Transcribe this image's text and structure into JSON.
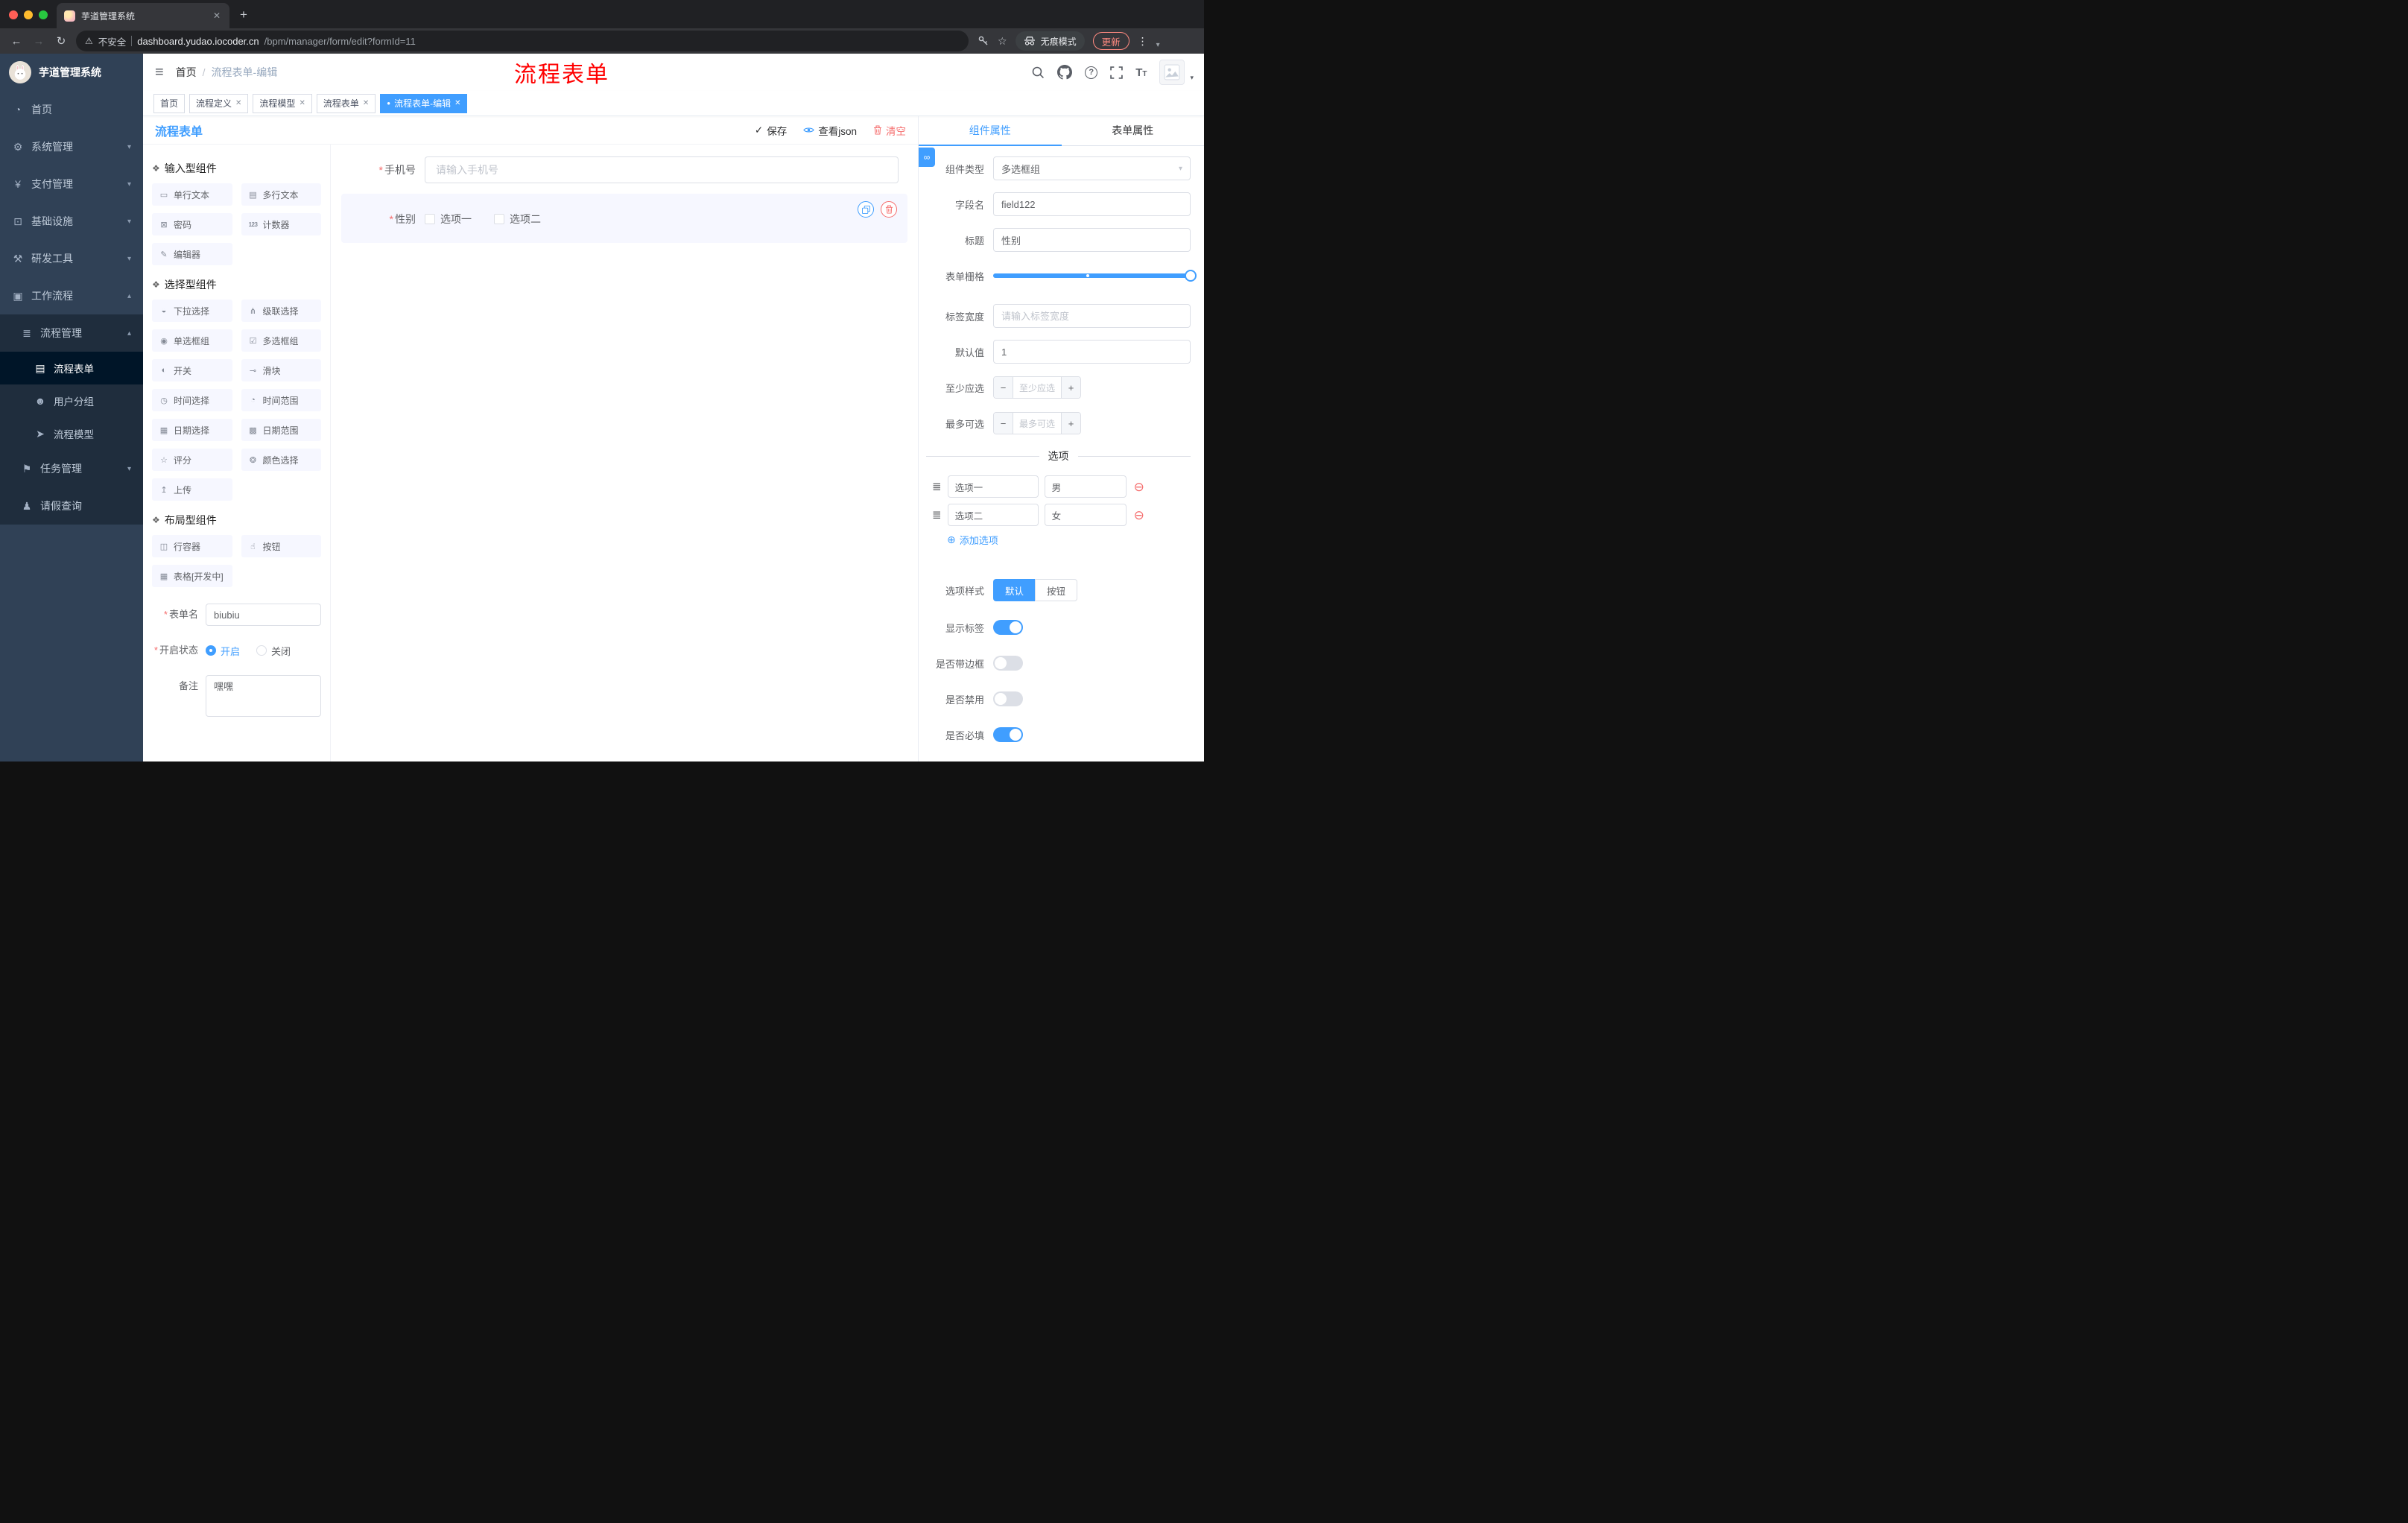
{
  "icons": {
    "back": "←",
    "forward": "→",
    "reload": "↻",
    "warning": "⚠",
    "star": "☆",
    "kebab": "⋮",
    "plus": "+",
    "close": "✕",
    "check": "✓",
    "dot": "●",
    "slash": "/",
    "hamburger": "≡",
    "question": "?",
    "caret_down": "▾",
    "caret_up": "▴",
    "minus": "−",
    "add_circle": "⊕",
    "remove_circle": "⊖",
    "drag_handle": "≣",
    "required": "*",
    "link": "∞",
    "group": "❖",
    "font_large": "T",
    "font_small": "T",
    "counter": "123"
  },
  "browser": {
    "tab_title": "芋道管理系统",
    "security_label": "不安全",
    "url_host": "dashboard.yudao.iocoder.cn",
    "url_path": "/bpm/manager/form/edit?formId=11",
    "incognito_label": "无痕模式",
    "update_label": "更新"
  },
  "sidebar": {
    "logo_title": "芋道管理系统",
    "menu": [
      {
        "label": "首页",
        "glyph": "◔"
      },
      {
        "label": "系统管理",
        "glyph": "⚙"
      },
      {
        "label": "支付管理",
        "glyph": "¥"
      },
      {
        "label": "基础设施",
        "glyph": "⊡"
      },
      {
        "label": "研发工具",
        "glyph": "⚒"
      },
      {
        "label": "工作流程",
        "glyph": "▣"
      },
      {
        "label": "流程管理",
        "glyph": "≣"
      },
      {
        "label": "流程表单",
        "glyph": "▤"
      },
      {
        "label": "用户分组",
        "glyph": "☻"
      },
      {
        "label": "流程模型",
        "glyph": "➤"
      },
      {
        "label": "任务管理",
        "glyph": "⚑"
      },
      {
        "label": "请假查询",
        "glyph": "♟"
      }
    ]
  },
  "header": {
    "breadcrumb_home": "首页",
    "breadcrumb_current": "流程表单-编辑",
    "watermark": "流程表单"
  },
  "tags": [
    {
      "label": "首页"
    },
    {
      "label": "流程定义"
    },
    {
      "label": "流程模型"
    },
    {
      "label": "流程表单"
    },
    {
      "label": "流程表单-编辑"
    }
  ],
  "designer": {
    "title": "流程表单",
    "save": "保存",
    "view_json": "查看json",
    "clear": "清空"
  },
  "components": {
    "groups": [
      {
        "title": "输入型组件",
        "items": [
          {
            "label": "单行文本",
            "glyph": "▭"
          },
          {
            "label": "多行文本",
            "glyph": "▤"
          },
          {
            "label": "密码",
            "glyph": "⊠"
          },
          {
            "label": "计数器",
            "glyph": "123"
          },
          {
            "label": "编辑器",
            "glyph": "✎"
          }
        ]
      },
      {
        "title": "选择型组件",
        "items": [
          {
            "label": "下拉选择",
            "glyph": "◒"
          },
          {
            "label": "级联选择",
            "glyph": "⋔"
          },
          {
            "label": "单选框组",
            "glyph": "◉"
          },
          {
            "label": "多选框组",
            "glyph": "☑"
          },
          {
            "label": "开关",
            "glyph": "◐"
          },
          {
            "label": "滑块",
            "glyph": "⊸"
          },
          {
            "label": "时间选择",
            "glyph": "◷"
          },
          {
            "label": "时间范围",
            "glyph": "◔"
          },
          {
            "label": "日期选择",
            "glyph": "▦"
          },
          {
            "label": "日期范围",
            "glyph": "▩"
          },
          {
            "label": "评分",
            "glyph": "☆"
          },
          {
            "label": "颜色选择",
            "glyph": "❂"
          },
          {
            "label": "上传",
            "glyph": "↥"
          }
        ]
      },
      {
        "title": "布局型组件",
        "items": [
          {
            "label": "行容器",
            "glyph": "◫"
          },
          {
            "label": "按钮",
            "glyph": "☝"
          },
          {
            "label": "表格[开发中]",
            "glyph": "▦"
          }
        ]
      }
    ],
    "form": {
      "name_label": "表单名",
      "name_value": "biubiu",
      "status_label": "开启状态",
      "status_on": "开启",
      "status_off": "关闭",
      "remark_label": "备注",
      "remark_value": "嘿嘿"
    }
  },
  "canvas": {
    "phone": {
      "label": "手机号",
      "placeholder": "请输入手机号"
    },
    "gender": {
      "label": "性别",
      "options": [
        {
          "label": "选项一"
        },
        {
          "label": "选项二"
        }
      ]
    }
  },
  "properties": {
    "tab_component": "组件属性",
    "tab_form": "表单属性",
    "rows": {
      "type_label": "组件类型",
      "type_value": "多选框组",
      "field_label": "字段名",
      "field_value": "field122",
      "title_label": "标题",
      "title_value": "性别",
      "grid_label": "表单栅格",
      "label_width_label": "标签宽度",
      "label_width_placeholder": "请输入标签宽度",
      "default_label": "默认值",
      "default_value": "1",
      "min_label": "至少应选",
      "min_placeholder": "至少应选",
      "max_label": "最多可选",
      "max_placeholder": "最多可选"
    },
    "options_divider": "选项",
    "options": [
      {
        "label": "选项一",
        "value": "男"
      },
      {
        "label": "选项二",
        "value": "女"
      }
    ],
    "add_option": "添加选项",
    "style_label": "选项样式",
    "style_default": "默认",
    "style_button": "按钮",
    "show_label": "显示标签",
    "border_label": "是否带边框",
    "disabled_label": "是否禁用",
    "required_label": "是否必填"
  },
  "colors": {
    "primary": "#409eff",
    "danger": "#f56c6c",
    "title_red": "#ff0000"
  }
}
